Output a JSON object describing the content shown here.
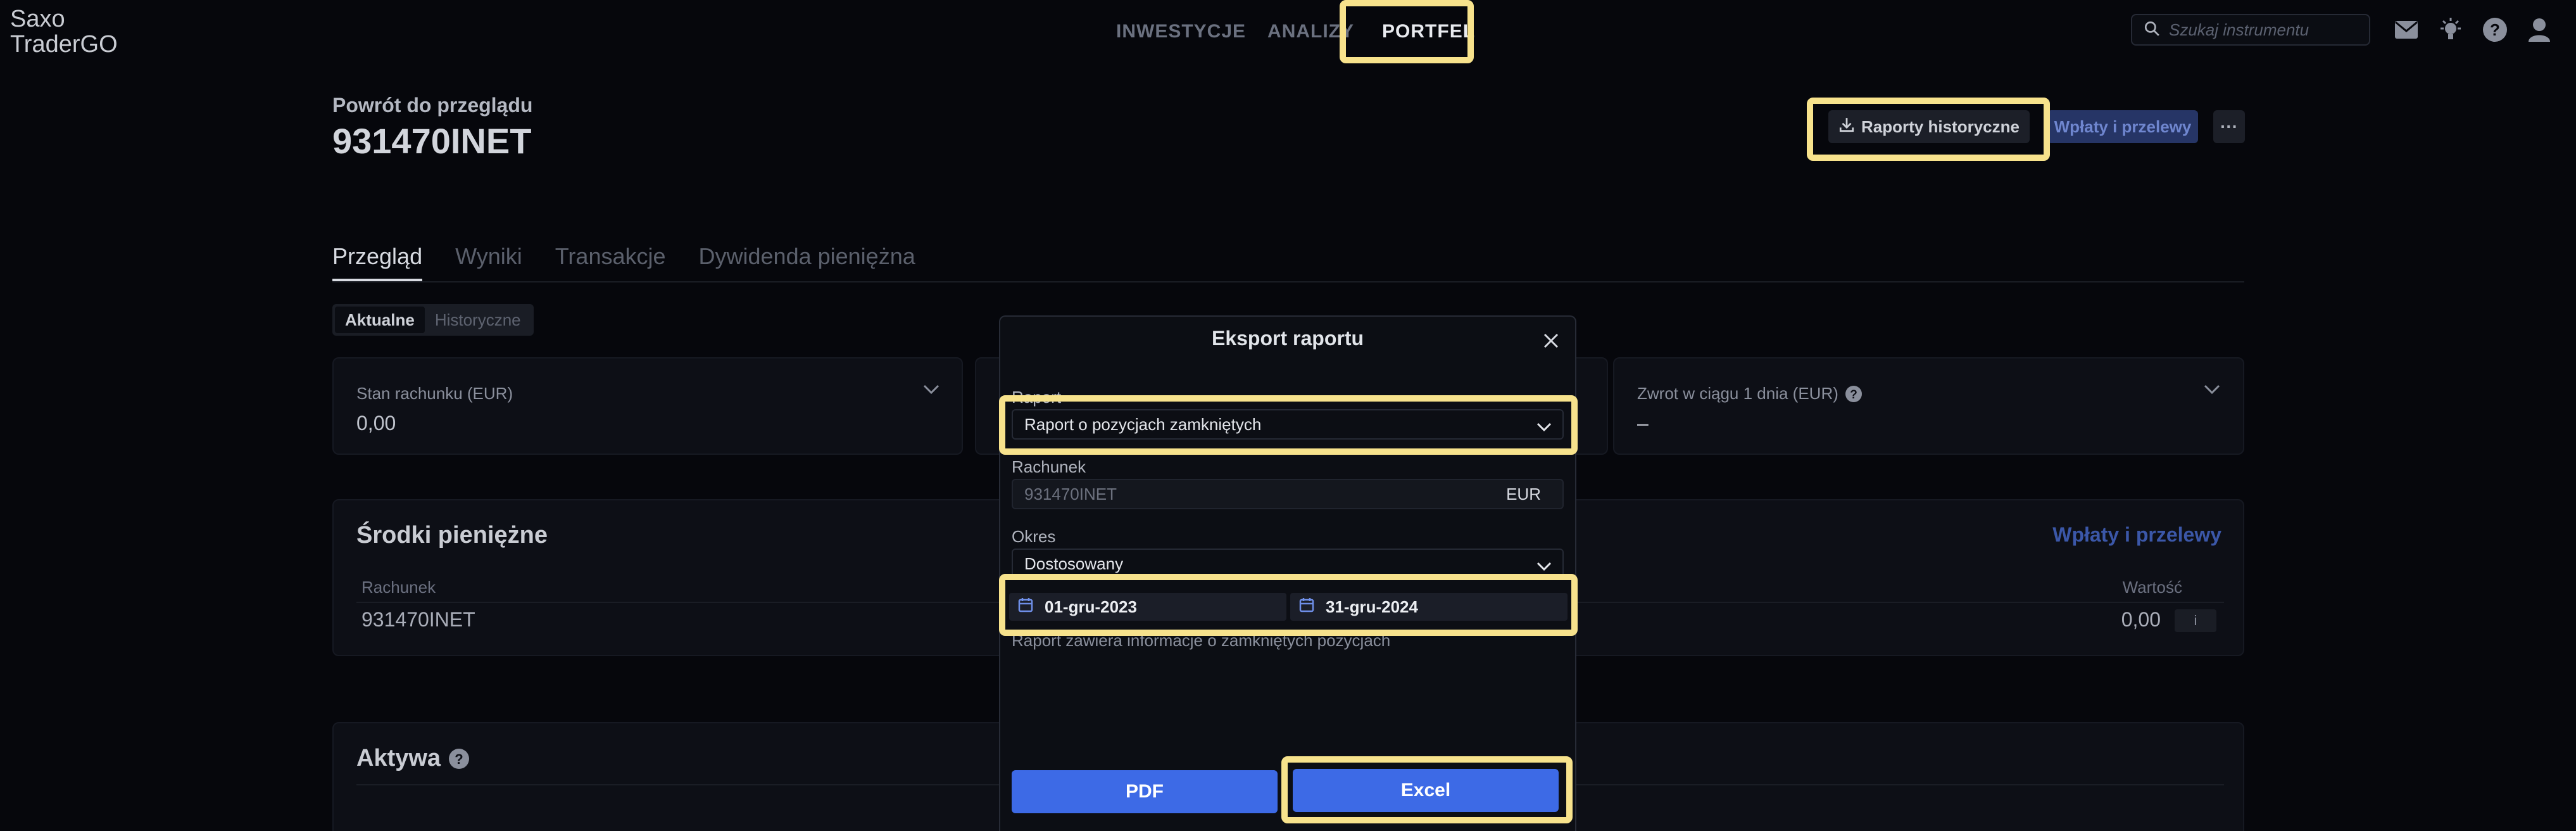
{
  "app": {
    "logo_line1": "Saxo",
    "logo_line2": "TraderGO"
  },
  "nav": {
    "items": [
      "INWESTYCJE",
      "ANALIZY",
      "PORTFEL"
    ],
    "active": "PORTFEL"
  },
  "search": {
    "placeholder": "Szukaj instrumentu"
  },
  "top_icons": [
    "mail-icon",
    "lightbulb-icon",
    "help-icon",
    "user-icon"
  ],
  "header": {
    "back_label": "Powrót do przeglądu",
    "account_title": "931470INET",
    "hist_reports_label": "Raporty historyczne",
    "deposits_label": "Wpłaty i przelewy",
    "more_label": "···"
  },
  "tabs": [
    "Przegląd",
    "Wyniki",
    "Transakcje",
    "Dywidenda pieniężna"
  ],
  "segment": [
    "Aktualne",
    "Historyczne"
  ],
  "cards": {
    "balance": {
      "title": "Stan rachunku (EUR)",
      "value": "0,00"
    },
    "return_1d": {
      "title": "Zwrot w ciągu 1 dnia (EUR)",
      "value": "–"
    }
  },
  "cash": {
    "title": "Środki pieniężne",
    "link": "Wpłaty i przelewy",
    "col_account": "Rachunek",
    "col_value": "Wartość",
    "row_account": "931470INET",
    "row_value": "0,00",
    "info": "i"
  },
  "assets": {
    "title": "Aktywa"
  },
  "modal": {
    "title": "Eksport raportu",
    "report_label": "Raport",
    "report_value": "Raport o pozycjach zamkniętych",
    "account_label": "Rachunek",
    "account_value": "931470INET",
    "account_currency": "EUR",
    "period_label": "Okres",
    "period_value": "Dostosowany",
    "date_from": "01-gru-2023",
    "date_to": "31-gru-2024",
    "description": "Raport zawiera informacje o zamkniętych pozycjach",
    "pdf_label": "PDF",
    "excel_label": "Excel"
  },
  "colors": {
    "accent": "#3d6ae6",
    "highlight": "#f7e28c",
    "background": "#06070c"
  }
}
